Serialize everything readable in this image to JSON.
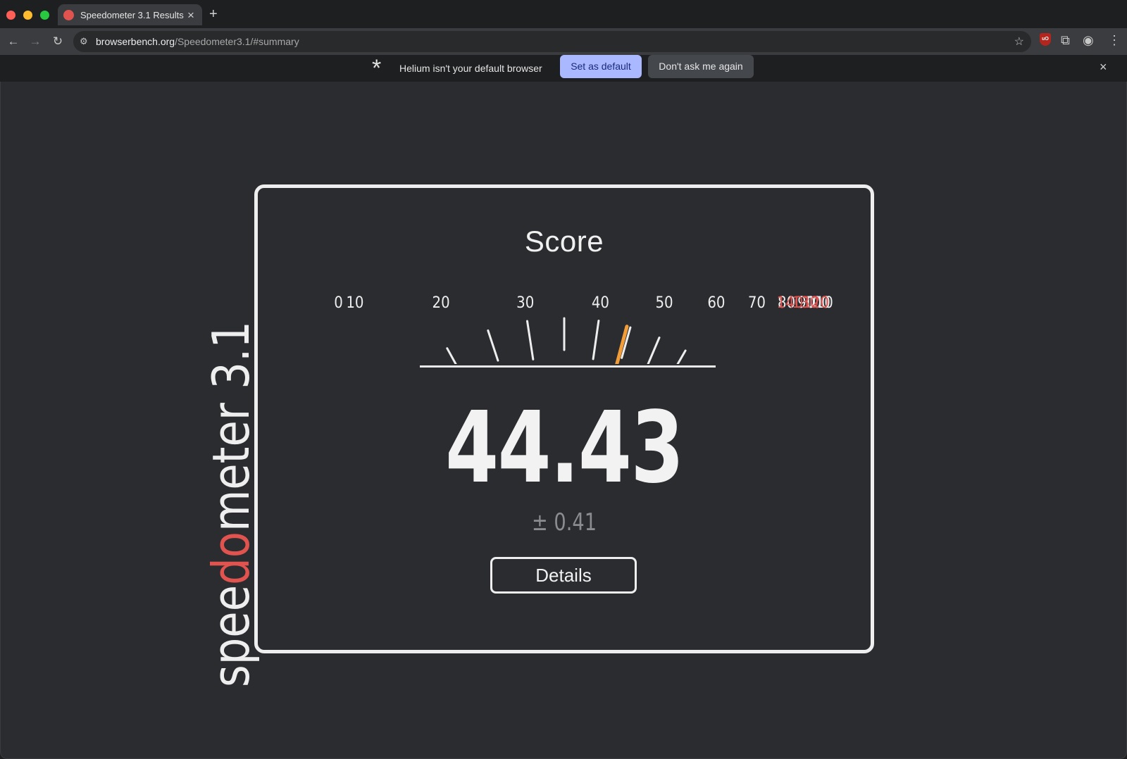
{
  "browser": {
    "tab": {
      "title": "Speedometer 3.1 Results",
      "close_glyph": "×"
    },
    "new_tab_glyph": "+",
    "nav": {
      "back_glyph": "←",
      "forward_glyph": "→",
      "reload_glyph": "↻"
    },
    "address": {
      "host": "browserbench.org",
      "path": "/Speedometer3.1/#summary"
    },
    "icons": {
      "site_info": "site-info-icon",
      "star": "bookmark-star-icon",
      "ublock": "ublock-origin-icon",
      "extensions": "puzzle-icon",
      "profile": "profile-icon",
      "menu": "kebab-menu-icon"
    }
  },
  "infobar": {
    "message": "Helium isn't your default browser",
    "set_default_label": "Set as default",
    "dont_ask_label": "Don't ask me again",
    "close_glyph": "×"
  },
  "logo": {
    "prefix": "spee",
    "accent": "do",
    "suffix": "meter",
    "version": " 3.1",
    "accent_color": "#e0534f"
  },
  "result": {
    "title": "Score",
    "value": "44.43",
    "error": "± 0.41",
    "details_label": "Details"
  },
  "gauge": {
    "min": 0,
    "max": 140,
    "labels": [
      "0",
      "10",
      "20",
      "30",
      "40",
      "50",
      "60",
      "70",
      "80",
      "90",
      "100",
      "110",
      "120",
      "130",
      "140"
    ],
    "redline_from": 120,
    "needle_value": 44.43,
    "tick_color": "#eeeeee",
    "red_color": "#e0534f",
    "needle_color": "#f29d38"
  }
}
